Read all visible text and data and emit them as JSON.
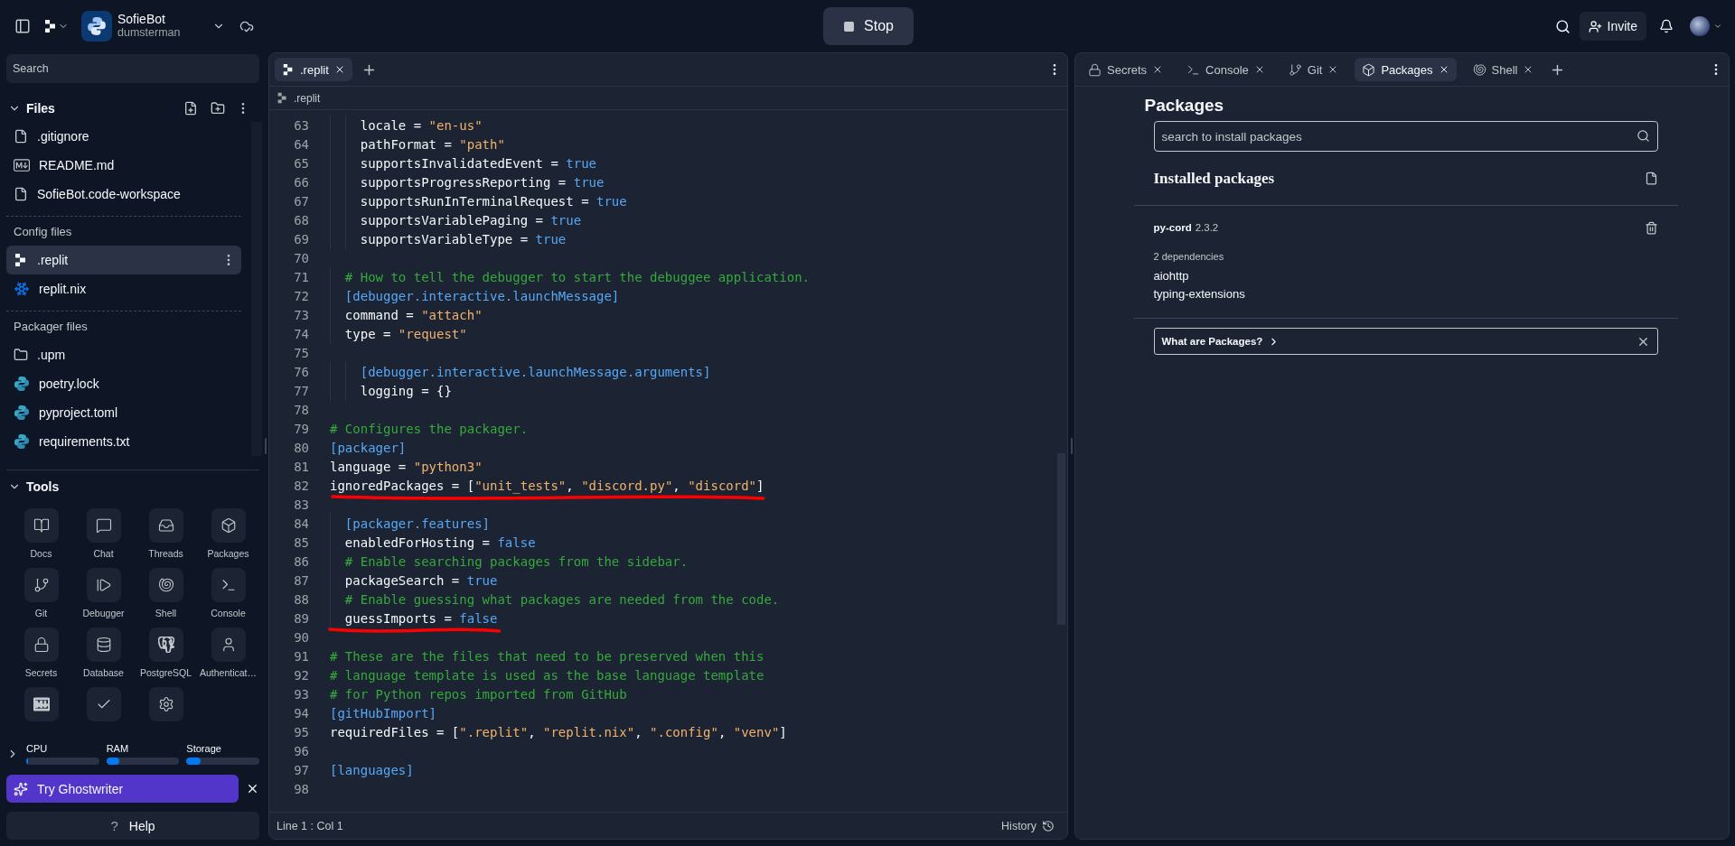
{
  "top_bar": {
    "project": {
      "name": "SofieBot",
      "owner": "dumsterman"
    },
    "run_button": {
      "label": "Stop"
    },
    "invite_button": {
      "label": "Invite"
    }
  },
  "sidebar": {
    "search": {
      "placeholder": "Search"
    },
    "files": {
      "title": "Files",
      "expanded": true,
      "items": [
        {
          "name": ".gitignore",
          "kind": "file",
          "selected": false
        },
        {
          "name": "README.md",
          "kind": "markdown",
          "selected": false
        },
        {
          "name": "SofieBot.code-workspace",
          "kind": "file",
          "selected": false
        }
      ]
    },
    "sections": [
      {
        "title": "Config files",
        "items": [
          {
            "name": ".replit",
            "kind": "replit",
            "selected": true
          },
          {
            "name": "replit.nix",
            "kind": "nix",
            "selected": false
          }
        ]
      },
      {
        "title": "Packager files",
        "items": [
          {
            "name": ".upm",
            "kind": "folder",
            "selected": false
          },
          {
            "name": "poetry.lock",
            "kind": "python",
            "selected": false
          },
          {
            "name": "pyproject.toml",
            "kind": "python",
            "selected": false
          },
          {
            "name": "requirements.txt",
            "kind": "python",
            "selected": false
          }
        ]
      }
    ],
    "tools": {
      "title": "Tools",
      "expanded": true,
      "items": [
        {
          "label": "Docs",
          "kind": "book"
        },
        {
          "label": "Chat",
          "kind": "chat"
        },
        {
          "label": "Threads",
          "kind": "inbox"
        },
        {
          "label": "Packages",
          "kind": "cube"
        },
        {
          "label": "Git",
          "kind": "branch"
        },
        {
          "label": "Debugger",
          "kind": "step"
        },
        {
          "label": "Shell",
          "kind": "shell"
        },
        {
          "label": "Console",
          "kind": "terminal"
        },
        {
          "label": "Secrets",
          "kind": "lock"
        },
        {
          "label": "Database",
          "kind": "database"
        },
        {
          "label": "PostgreSQL",
          "kind": "elephant"
        },
        {
          "label": "Authenticat…",
          "kind": "user"
        },
        {
          "kind": "markdown"
        },
        {
          "kind": "check"
        },
        {
          "kind": "gear"
        }
      ]
    },
    "resources": {
      "expanded": false,
      "meters": [
        {
          "label": "CPU",
          "level": 0.02
        },
        {
          "label": "RAM",
          "level": 0.18
        },
        {
          "label": "Storage",
          "level": 0.19
        }
      ]
    },
    "ghostwriter": {
      "label": "Try Ghostwriter"
    },
    "help": {
      "icon": "?",
      "label": "Help"
    }
  },
  "editor": {
    "tabs": [
      {
        "label": ".replit",
        "selected": true
      }
    ],
    "breadcrumb": ".replit",
    "lines": [
      {
        "n": "63",
        "underlined": false,
        "tokens": [
          {
            "kind": "key",
            "text": "    locale = "
          },
          {
            "kind": "string",
            "text": "\"en-us\""
          }
        ]
      },
      {
        "n": "64",
        "underlined": false,
        "tokens": [
          {
            "kind": "key",
            "text": "    pathFormat = "
          },
          {
            "kind": "string",
            "text": "\"path\""
          }
        ]
      },
      {
        "n": "65",
        "underlined": false,
        "tokens": [
          {
            "kind": "key",
            "text": "    supportsInvalidatedEvent = "
          },
          {
            "kind": "bool",
            "text": "true"
          }
        ]
      },
      {
        "n": "66",
        "underlined": false,
        "tokens": [
          {
            "kind": "key",
            "text": "    supportsProgressReporting = "
          },
          {
            "kind": "bool",
            "text": "true"
          }
        ]
      },
      {
        "n": "67",
        "underlined": false,
        "tokens": [
          {
            "kind": "key",
            "text": "    supportsRunInTerminalRequest = "
          },
          {
            "kind": "bool",
            "text": "true"
          }
        ]
      },
      {
        "n": "68",
        "underlined": false,
        "tokens": [
          {
            "kind": "key",
            "text": "    supportsVariablePaging = "
          },
          {
            "kind": "bool",
            "text": "true"
          }
        ]
      },
      {
        "n": "69",
        "underlined": false,
        "tokens": [
          {
            "kind": "key",
            "text": "    supportsVariableType = "
          },
          {
            "kind": "bool",
            "text": "true"
          }
        ]
      },
      {
        "n": "70",
        "underlined": false
      },
      {
        "n": "71",
        "underlined": false,
        "tokens": [
          {
            "kind": "comment",
            "text": "  # How to tell the debugger to start the debuggee application."
          }
        ]
      },
      {
        "n": "72",
        "underlined": false,
        "tokens": [
          {
            "kind": "section",
            "text": "  [debugger.interactive.launchMessage]"
          }
        ]
      },
      {
        "n": "73",
        "underlined": false,
        "tokens": [
          {
            "kind": "key",
            "text": "  command = "
          },
          {
            "kind": "string",
            "text": "\"attach\""
          }
        ]
      },
      {
        "n": "74",
        "underlined": false,
        "tokens": [
          {
            "kind": "key",
            "text": "  type = "
          },
          {
            "kind": "string",
            "text": "\"request\""
          }
        ]
      },
      {
        "n": "75",
        "underlined": false
      },
      {
        "n": "76",
        "underlined": false,
        "tokens": [
          {
            "kind": "section",
            "text": "    [debugger.interactive.launchMessage.arguments]"
          }
        ]
      },
      {
        "n": "77",
        "underlined": false,
        "tokens": [
          {
            "kind": "key",
            "text": "    logging = {}"
          }
        ]
      },
      {
        "n": "78",
        "underlined": false
      },
      {
        "n": "79",
        "underlined": false,
        "tokens": [
          {
            "kind": "comment",
            "text": "# Configures the packager."
          }
        ]
      },
      {
        "n": "80",
        "underlined": false,
        "tokens": [
          {
            "kind": "section",
            "text": "[packager]"
          }
        ]
      },
      {
        "n": "81",
        "underlined": false,
        "tokens": [
          {
            "kind": "key",
            "text": "language = "
          },
          {
            "kind": "string",
            "text": "\"python3\""
          }
        ]
      },
      {
        "n": "82",
        "underlined": true,
        "tokens": [
          {
            "kind": "key",
            "text": "ignoredPackages = ["
          },
          {
            "kind": "string",
            "text": "\"unit_tests\""
          },
          {
            "kind": "key",
            "text": ", "
          },
          {
            "kind": "string",
            "text": "\"discord.py\""
          },
          {
            "kind": "key",
            "text": ", "
          },
          {
            "kind": "string",
            "text": "\"discord\""
          },
          {
            "kind": "key",
            "text": "]"
          }
        ]
      },
      {
        "n": "83",
        "underlined": false
      },
      {
        "n": "84",
        "underlined": false,
        "tokens": [
          {
            "kind": "section",
            "text": "  [packager.features]"
          }
        ]
      },
      {
        "n": "85",
        "underlined": false,
        "tokens": [
          {
            "kind": "key",
            "text": "  enabledForHosting = "
          },
          {
            "kind": "bool",
            "text": "false"
          }
        ]
      },
      {
        "n": "86",
        "underlined": false,
        "tokens": [
          {
            "kind": "comment",
            "text": "  # Enable searching packages from the sidebar."
          }
        ]
      },
      {
        "n": "87",
        "underlined": false,
        "tokens": [
          {
            "kind": "key",
            "text": "  packageSearch = "
          },
          {
            "kind": "bool",
            "text": "true"
          }
        ]
      },
      {
        "n": "88",
        "underlined": false,
        "tokens": [
          {
            "kind": "comment",
            "text": "  # Enable guessing what packages are needed from the code."
          }
        ]
      },
      {
        "n": "89",
        "underlined": true,
        "tokens": [
          {
            "kind": "key",
            "text": "  guessImports = "
          },
          {
            "kind": "bool",
            "text": "false"
          }
        ]
      },
      {
        "n": "90",
        "underlined": false
      },
      {
        "n": "91",
        "underlined": false,
        "tokens": [
          {
            "kind": "comment",
            "text": "# These are the files that need to be preserved when this"
          }
        ]
      },
      {
        "n": "92",
        "underlined": false,
        "tokens": [
          {
            "kind": "comment",
            "text": "# language template is used as the base language template"
          }
        ]
      },
      {
        "n": "93",
        "underlined": false,
        "tokens": [
          {
            "kind": "comment",
            "text": "# for Python repos imported from GitHub"
          }
        ]
      },
      {
        "n": "94",
        "underlined": false,
        "tokens": [
          {
            "kind": "section",
            "text": "[gitHubImport]"
          }
        ]
      },
      {
        "n": "95",
        "underlined": false,
        "tokens": [
          {
            "kind": "key",
            "text": "requiredFiles = ["
          },
          {
            "kind": "string",
            "text": "\".replit\""
          },
          {
            "kind": "key",
            "text": ", "
          },
          {
            "kind": "string",
            "text": "\"replit.nix\""
          },
          {
            "kind": "key",
            "text": ", "
          },
          {
            "kind": "string",
            "text": "\".config\""
          },
          {
            "kind": "key",
            "text": ", "
          },
          {
            "kind": "string",
            "text": "\"venv\""
          },
          {
            "kind": "key",
            "text": "]"
          }
        ]
      },
      {
        "n": "96",
        "underlined": false
      },
      {
        "n": "97",
        "underlined": false,
        "tokens": [
          {
            "kind": "section",
            "text": "[languages]"
          }
        ]
      },
      {
        "n": "98",
        "underlined": false
      }
    ],
    "status": {
      "position": "Line 1 : Col 1",
      "history": "History"
    }
  },
  "panel": {
    "tabs": [
      {
        "label": "Secrets",
        "kind": "lock",
        "selected": false
      },
      {
        "label": "Console",
        "kind": "terminal",
        "selected": false
      },
      {
        "label": "Git",
        "kind": "branch",
        "selected": false
      },
      {
        "label": "Packages",
        "kind": "cube",
        "selected": true
      },
      {
        "label": "Shell",
        "kind": "shell",
        "selected": false
      }
    ],
    "title": "Packages",
    "search": {
      "placeholder": "search to install packages"
    },
    "installed_title": "Installed packages",
    "packages": [
      {
        "name": "py-cord",
        "version": "2.3.2",
        "dependency_count": "2 dependencies",
        "dependencies": [
          "aiohttp",
          "typing-extensions"
        ]
      }
    ],
    "help_banner": {
      "label": "What are Packages?"
    }
  }
}
